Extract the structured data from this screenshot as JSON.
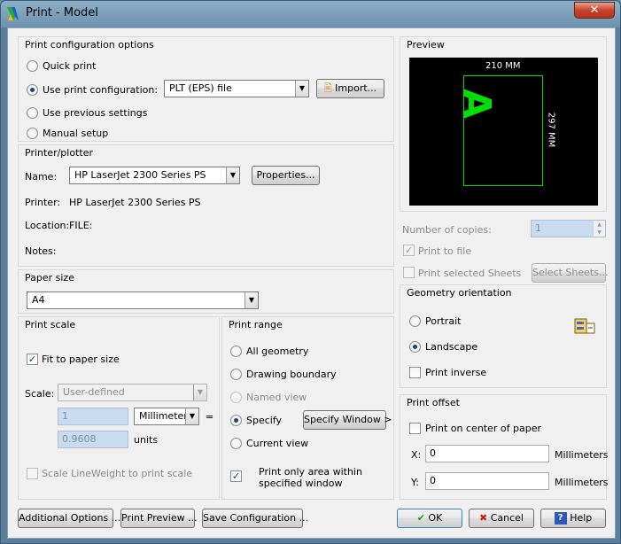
{
  "window": {
    "title": "Print - Model",
    "close_glyph": "✕"
  },
  "config": {
    "heading": "Print configuration options",
    "quick": "Quick print",
    "use_config": "Use print configuration:",
    "config_value": "PLT (EPS) file",
    "import": "Import...",
    "previous": "Use previous settings",
    "manual": "Manual setup"
  },
  "printer": {
    "heading": "Printer/plotter",
    "name_label": "Name:",
    "name_value": "HP LaserJet 2300 Series PS",
    "properties": "Properties...",
    "printer_label": "Printer:",
    "printer_value": "HP LaserJet 2300 Series PS",
    "location_label": "Location:",
    "location_value": "FILE:",
    "notes_label": "Notes:"
  },
  "paper": {
    "heading": "Paper size",
    "value": "A4"
  },
  "scale": {
    "heading": "Print scale",
    "fit": "Fit to paper size",
    "scale_label": "Scale:",
    "scale_value": "User-defined",
    "value1": "1",
    "unit": "Millimeters",
    "equals": "=",
    "value2": "0.9608",
    "units": "units",
    "lineweight": "Scale LineWeight to print scale"
  },
  "range": {
    "heading": "Print range",
    "all": "All geometry",
    "boundary": "Drawing boundary",
    "named": "Named view",
    "specify": "Specify",
    "specify_window": "Specify Window >",
    "current": "Current view",
    "only_area": "Print only area within specified window"
  },
  "preview": {
    "heading": "Preview",
    "width_label": "210 MM",
    "height_label": "297 MM",
    "letter": "A"
  },
  "copies": {
    "label": "Number of copies:",
    "value": "1"
  },
  "file": {
    "print_to_file": "Print to file",
    "selected": "Print selected Sheets",
    "select_btn": "Select Sheets..."
  },
  "orientation": {
    "heading": "Geometry orientation",
    "portrait": "Portrait",
    "landscape": "Landscape",
    "inverse": "Print inverse"
  },
  "offset": {
    "heading": "Print offset",
    "center": "Print on center of paper",
    "x_label": "X:",
    "x_value": "0",
    "y_label": "Y:",
    "y_value": "0",
    "unit_x": "Millimeters",
    "unit_y": "Millimeters"
  },
  "buttons": {
    "additional": "Additional Options ...",
    "preview": "Print Preview ...",
    "save": "Save Configuration ...",
    "ok": "OK",
    "cancel": "Cancel",
    "help": "Help"
  },
  "colors": {
    "preview_green": "#00e000",
    "ok_green": "#1b9a1b",
    "cancel_red": "#cc1a1a",
    "help_blue": "#2a5ab5"
  }
}
